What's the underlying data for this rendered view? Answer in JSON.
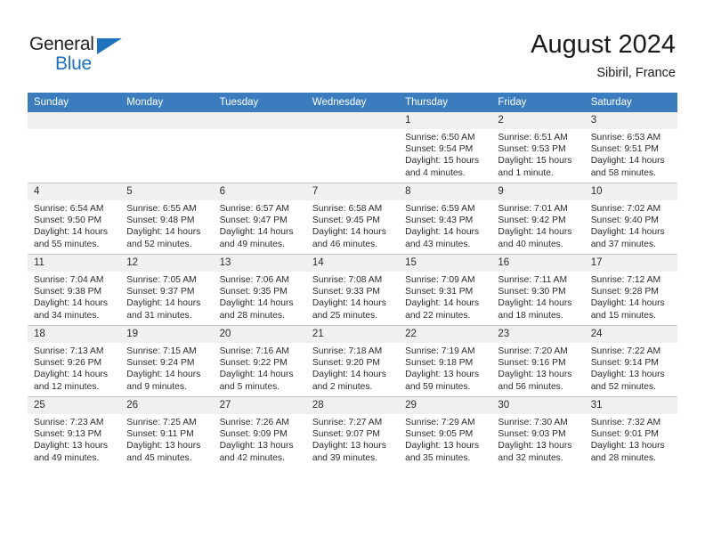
{
  "brand": {
    "name_part1": "General",
    "name_part2": "Blue",
    "accent_color": "#1f72bd",
    "text_color": "#231f20"
  },
  "header": {
    "title": "August 2024",
    "subtitle": "Sibiril, France"
  },
  "theme": {
    "header_row_bg": "#3a7cbe",
    "header_row_text": "#ffffff",
    "daynum_bg": "#f0f0f0",
    "grid_line": "#c8c8c8"
  },
  "weekday_headers": [
    "Sunday",
    "Monday",
    "Tuesday",
    "Wednesday",
    "Thursday",
    "Friday",
    "Saturday"
  ],
  "weeks": [
    [
      {
        "day": "",
        "empty": true,
        "sunrise": "",
        "sunset": "",
        "daylight1": "",
        "daylight2": ""
      },
      {
        "day": "",
        "empty": true,
        "sunrise": "",
        "sunset": "",
        "daylight1": "",
        "daylight2": ""
      },
      {
        "day": "",
        "empty": true,
        "sunrise": "",
        "sunset": "",
        "daylight1": "",
        "daylight2": ""
      },
      {
        "day": "",
        "empty": true,
        "sunrise": "",
        "sunset": "",
        "daylight1": "",
        "daylight2": ""
      },
      {
        "day": "1",
        "empty": false,
        "sunrise": "Sunrise: 6:50 AM",
        "sunset": "Sunset: 9:54 PM",
        "daylight1": "Daylight: 15 hours",
        "daylight2": "and 4 minutes."
      },
      {
        "day": "2",
        "empty": false,
        "sunrise": "Sunrise: 6:51 AM",
        "sunset": "Sunset: 9:53 PM",
        "daylight1": "Daylight: 15 hours",
        "daylight2": "and 1 minute."
      },
      {
        "day": "3",
        "empty": false,
        "sunrise": "Sunrise: 6:53 AM",
        "sunset": "Sunset: 9:51 PM",
        "daylight1": "Daylight: 14 hours",
        "daylight2": "and 58 minutes."
      }
    ],
    [
      {
        "day": "4",
        "empty": false,
        "sunrise": "Sunrise: 6:54 AM",
        "sunset": "Sunset: 9:50 PM",
        "daylight1": "Daylight: 14 hours",
        "daylight2": "and 55 minutes."
      },
      {
        "day": "5",
        "empty": false,
        "sunrise": "Sunrise: 6:55 AM",
        "sunset": "Sunset: 9:48 PM",
        "daylight1": "Daylight: 14 hours",
        "daylight2": "and 52 minutes."
      },
      {
        "day": "6",
        "empty": false,
        "sunrise": "Sunrise: 6:57 AM",
        "sunset": "Sunset: 9:47 PM",
        "daylight1": "Daylight: 14 hours",
        "daylight2": "and 49 minutes."
      },
      {
        "day": "7",
        "empty": false,
        "sunrise": "Sunrise: 6:58 AM",
        "sunset": "Sunset: 9:45 PM",
        "daylight1": "Daylight: 14 hours",
        "daylight2": "and 46 minutes."
      },
      {
        "day": "8",
        "empty": false,
        "sunrise": "Sunrise: 6:59 AM",
        "sunset": "Sunset: 9:43 PM",
        "daylight1": "Daylight: 14 hours",
        "daylight2": "and 43 minutes."
      },
      {
        "day": "9",
        "empty": false,
        "sunrise": "Sunrise: 7:01 AM",
        "sunset": "Sunset: 9:42 PM",
        "daylight1": "Daylight: 14 hours",
        "daylight2": "and 40 minutes."
      },
      {
        "day": "10",
        "empty": false,
        "sunrise": "Sunrise: 7:02 AM",
        "sunset": "Sunset: 9:40 PM",
        "daylight1": "Daylight: 14 hours",
        "daylight2": "and 37 minutes."
      }
    ],
    [
      {
        "day": "11",
        "empty": false,
        "sunrise": "Sunrise: 7:04 AM",
        "sunset": "Sunset: 9:38 PM",
        "daylight1": "Daylight: 14 hours",
        "daylight2": "and 34 minutes."
      },
      {
        "day": "12",
        "empty": false,
        "sunrise": "Sunrise: 7:05 AM",
        "sunset": "Sunset: 9:37 PM",
        "daylight1": "Daylight: 14 hours",
        "daylight2": "and 31 minutes."
      },
      {
        "day": "13",
        "empty": false,
        "sunrise": "Sunrise: 7:06 AM",
        "sunset": "Sunset: 9:35 PM",
        "daylight1": "Daylight: 14 hours",
        "daylight2": "and 28 minutes."
      },
      {
        "day": "14",
        "empty": false,
        "sunrise": "Sunrise: 7:08 AM",
        "sunset": "Sunset: 9:33 PM",
        "daylight1": "Daylight: 14 hours",
        "daylight2": "and 25 minutes."
      },
      {
        "day": "15",
        "empty": false,
        "sunrise": "Sunrise: 7:09 AM",
        "sunset": "Sunset: 9:31 PM",
        "daylight1": "Daylight: 14 hours",
        "daylight2": "and 22 minutes."
      },
      {
        "day": "16",
        "empty": false,
        "sunrise": "Sunrise: 7:11 AM",
        "sunset": "Sunset: 9:30 PM",
        "daylight1": "Daylight: 14 hours",
        "daylight2": "and 18 minutes."
      },
      {
        "day": "17",
        "empty": false,
        "sunrise": "Sunrise: 7:12 AM",
        "sunset": "Sunset: 9:28 PM",
        "daylight1": "Daylight: 14 hours",
        "daylight2": "and 15 minutes."
      }
    ],
    [
      {
        "day": "18",
        "empty": false,
        "sunrise": "Sunrise: 7:13 AM",
        "sunset": "Sunset: 9:26 PM",
        "daylight1": "Daylight: 14 hours",
        "daylight2": "and 12 minutes."
      },
      {
        "day": "19",
        "empty": false,
        "sunrise": "Sunrise: 7:15 AM",
        "sunset": "Sunset: 9:24 PM",
        "daylight1": "Daylight: 14 hours",
        "daylight2": "and 9 minutes."
      },
      {
        "day": "20",
        "empty": false,
        "sunrise": "Sunrise: 7:16 AM",
        "sunset": "Sunset: 9:22 PM",
        "daylight1": "Daylight: 14 hours",
        "daylight2": "and 5 minutes."
      },
      {
        "day": "21",
        "empty": false,
        "sunrise": "Sunrise: 7:18 AM",
        "sunset": "Sunset: 9:20 PM",
        "daylight1": "Daylight: 14 hours",
        "daylight2": "and 2 minutes."
      },
      {
        "day": "22",
        "empty": false,
        "sunrise": "Sunrise: 7:19 AM",
        "sunset": "Sunset: 9:18 PM",
        "daylight1": "Daylight: 13 hours",
        "daylight2": "and 59 minutes."
      },
      {
        "day": "23",
        "empty": false,
        "sunrise": "Sunrise: 7:20 AM",
        "sunset": "Sunset: 9:16 PM",
        "daylight1": "Daylight: 13 hours",
        "daylight2": "and 56 minutes."
      },
      {
        "day": "24",
        "empty": false,
        "sunrise": "Sunrise: 7:22 AM",
        "sunset": "Sunset: 9:14 PM",
        "daylight1": "Daylight: 13 hours",
        "daylight2": "and 52 minutes."
      }
    ],
    [
      {
        "day": "25",
        "empty": false,
        "sunrise": "Sunrise: 7:23 AM",
        "sunset": "Sunset: 9:13 PM",
        "daylight1": "Daylight: 13 hours",
        "daylight2": "and 49 minutes."
      },
      {
        "day": "26",
        "empty": false,
        "sunrise": "Sunrise: 7:25 AM",
        "sunset": "Sunset: 9:11 PM",
        "daylight1": "Daylight: 13 hours",
        "daylight2": "and 45 minutes."
      },
      {
        "day": "27",
        "empty": false,
        "sunrise": "Sunrise: 7:26 AM",
        "sunset": "Sunset: 9:09 PM",
        "daylight1": "Daylight: 13 hours",
        "daylight2": "and 42 minutes."
      },
      {
        "day": "28",
        "empty": false,
        "sunrise": "Sunrise: 7:27 AM",
        "sunset": "Sunset: 9:07 PM",
        "daylight1": "Daylight: 13 hours",
        "daylight2": "and 39 minutes."
      },
      {
        "day": "29",
        "empty": false,
        "sunrise": "Sunrise: 7:29 AM",
        "sunset": "Sunset: 9:05 PM",
        "daylight1": "Daylight: 13 hours",
        "daylight2": "and 35 minutes."
      },
      {
        "day": "30",
        "empty": false,
        "sunrise": "Sunrise: 7:30 AM",
        "sunset": "Sunset: 9:03 PM",
        "daylight1": "Daylight: 13 hours",
        "daylight2": "and 32 minutes."
      },
      {
        "day": "31",
        "empty": false,
        "sunrise": "Sunrise: 7:32 AM",
        "sunset": "Sunset: 9:01 PM",
        "daylight1": "Daylight: 13 hours",
        "daylight2": "and 28 minutes."
      }
    ]
  ]
}
